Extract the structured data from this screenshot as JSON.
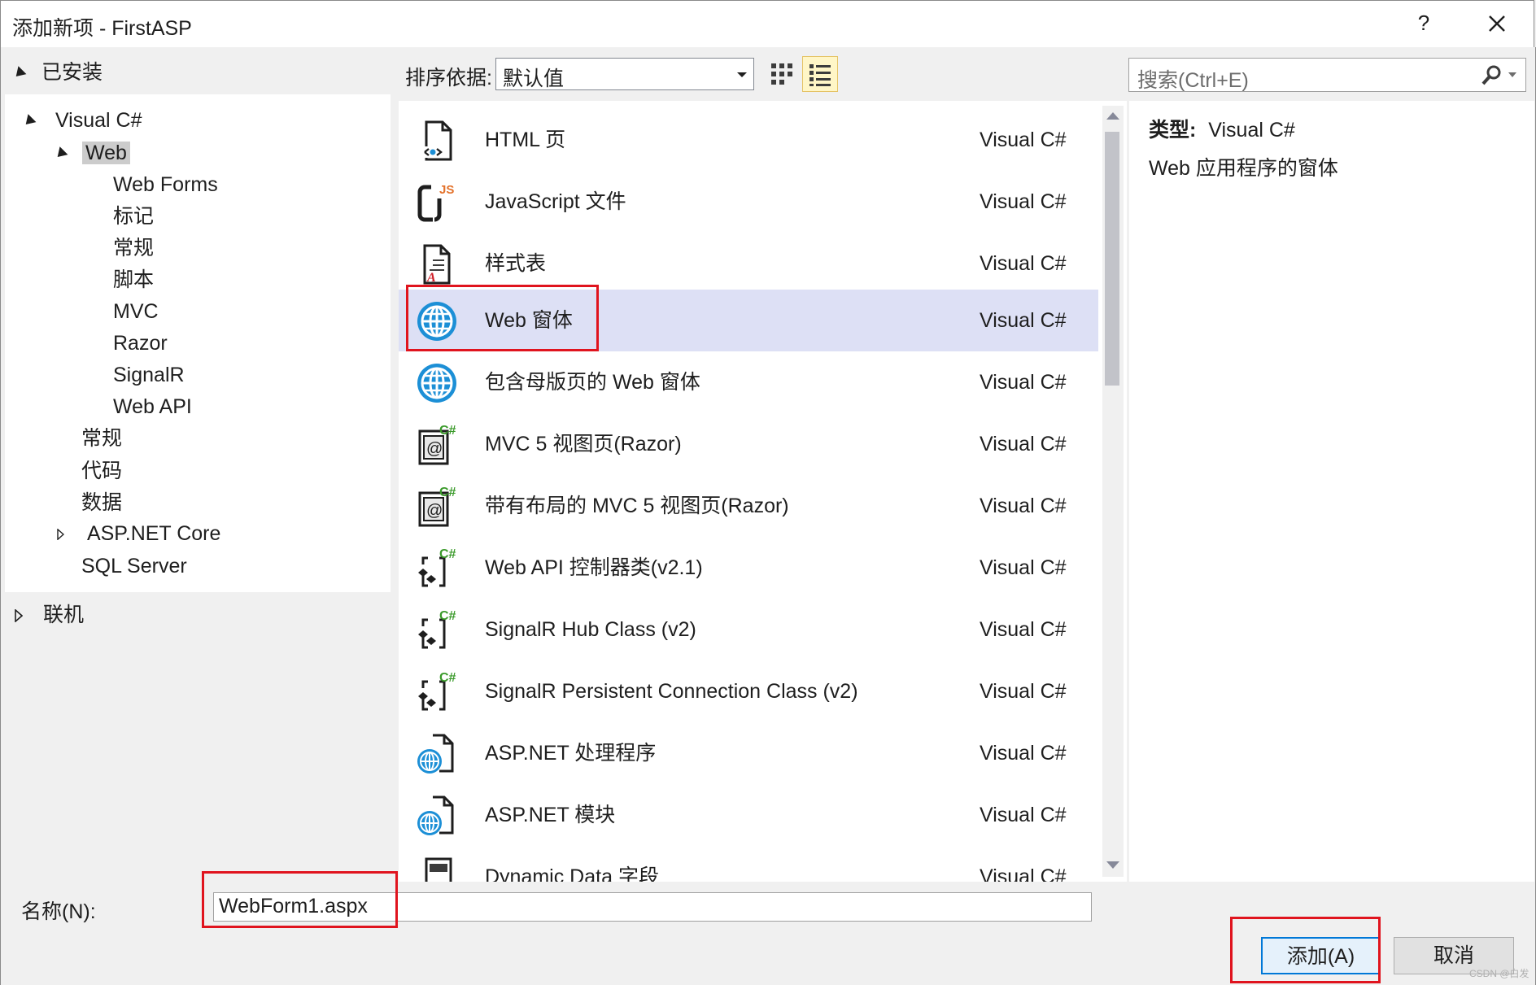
{
  "window": {
    "title": "添加新项 - FirstASP",
    "help_label": "?"
  },
  "left_nav": {
    "installed_label": "已安装",
    "online_label": "联机",
    "tree": [
      {
        "label": "Visual C#",
        "expanded": true
      },
      {
        "label": "Web",
        "expanded": true,
        "selected": true
      },
      {
        "label": "Web Forms"
      },
      {
        "label": "标记"
      },
      {
        "label": "常规"
      },
      {
        "label": "脚本"
      },
      {
        "label": "MVC"
      },
      {
        "label": "Razor"
      },
      {
        "label": "SignalR"
      },
      {
        "label": "Web API"
      },
      {
        "label": "常规"
      },
      {
        "label": "代码"
      },
      {
        "label": "数据"
      },
      {
        "label": "ASP.NET Core",
        "expanded": false
      },
      {
        "label": "SQL Server"
      }
    ]
  },
  "toolbar": {
    "sort_label": "排序依据:",
    "sort_value": "默认值",
    "search_placeholder": "搜索(Ctrl+E)"
  },
  "templates": [
    {
      "name": "HTML 页",
      "lang": "Visual C#",
      "icon": "html-page-icon"
    },
    {
      "name": "JavaScript 文件",
      "lang": "Visual C#",
      "icon": "javascript-file-icon"
    },
    {
      "name": "样式表",
      "lang": "Visual C#",
      "icon": "stylesheet-icon"
    },
    {
      "name": "Web 窗体",
      "lang": "Visual C#",
      "icon": "globe-icon",
      "selected": true
    },
    {
      "name": "包含母版页的 Web 窗体",
      "lang": "Visual C#",
      "icon": "globe-icon"
    },
    {
      "name": "MVC 5 视图页(Razor)",
      "lang": "Visual C#",
      "icon": "razor-view-icon"
    },
    {
      "name": "带有布局的 MVC 5 视图页(Razor)",
      "lang": "Visual C#",
      "icon": "razor-view-icon"
    },
    {
      "name": "Web API 控制器类(v2.1)",
      "lang": "Visual C#",
      "icon": "csharp-class-icon"
    },
    {
      "name": "SignalR Hub Class (v2)",
      "lang": "Visual C#",
      "icon": "csharp-class-icon"
    },
    {
      "name": "SignalR Persistent Connection Class (v2)",
      "lang": "Visual C#",
      "icon": "csharp-class-icon"
    },
    {
      "name": "ASP.NET 处理程序",
      "lang": "Visual C#",
      "icon": "web-handler-icon"
    },
    {
      "name": "ASP.NET 模块",
      "lang": "Visual C#",
      "icon": "web-handler-icon"
    },
    {
      "name": "Dynamic Data 字段",
      "lang": "Visual C#",
      "icon": "dynamic-data-icon"
    }
  ],
  "details": {
    "type_label": "类型:",
    "type_value": "Visual C#",
    "description": "Web 应用程序的窗体"
  },
  "bottom": {
    "name_label": "名称(N):",
    "name_value": "WebForm1.aspx",
    "add_label": "添加(A)",
    "cancel_label": "取消",
    "watermark": "CSDN @白发"
  },
  "colors": {
    "selection": "#dde0f5",
    "highlight_box": "#e0141e",
    "accent": "#0078d7",
    "icon_blue": "#1c8fd6"
  }
}
